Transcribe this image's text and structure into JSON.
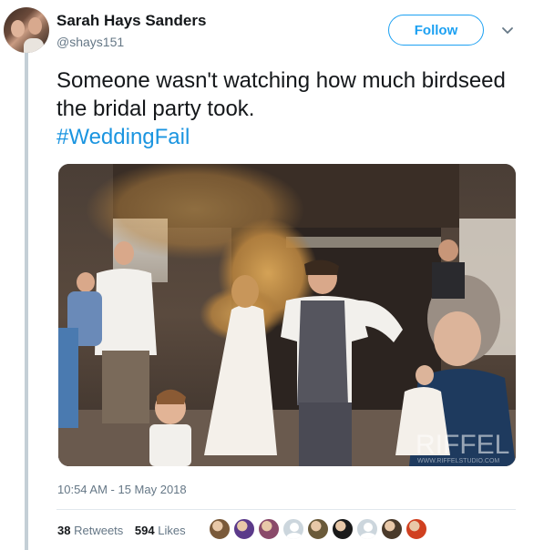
{
  "tweet": {
    "author_name": "Sarah Hays Sanders",
    "author_handle": "@shays151",
    "follow_label": "Follow",
    "text": "Someone wasn't watching how much birdseed the bridal party took.",
    "hashtag": "#WeddingFail",
    "timestamp": "10:54 AM - 15 May 2018",
    "retweets_count": "38",
    "retweets_label": "Retweets",
    "likes_count": "594",
    "likes_label": "Likes"
  },
  "media": {
    "watermark": "RIFFEL",
    "watermark_url": "WWW.RIFFELSTUDIO.COM"
  },
  "colors": {
    "accent": "#1da1f2",
    "hashtag": "#1b95e0",
    "secondary_text": "#657786",
    "thread_line": "#c4cfd6"
  },
  "likers": [
    {
      "icon": "liker-avatar-1",
      "color": "#7a5a3a"
    },
    {
      "icon": "liker-avatar-2",
      "color": "#5b3a8a"
    },
    {
      "icon": "liker-avatar-3",
      "color": "#8a4a6a"
    },
    {
      "icon": "liker-avatar-default",
      "color": "#ccd6dd"
    },
    {
      "icon": "liker-avatar-4",
      "color": "#6a5a3a"
    },
    {
      "icon": "liker-avatar-5",
      "color": "#1a1a1a"
    },
    {
      "icon": "liker-avatar-default",
      "color": "#ccd6dd"
    },
    {
      "icon": "liker-avatar-6",
      "color": "#4a3a2a"
    },
    {
      "icon": "liker-avatar-7",
      "color": "#d04020"
    }
  ]
}
